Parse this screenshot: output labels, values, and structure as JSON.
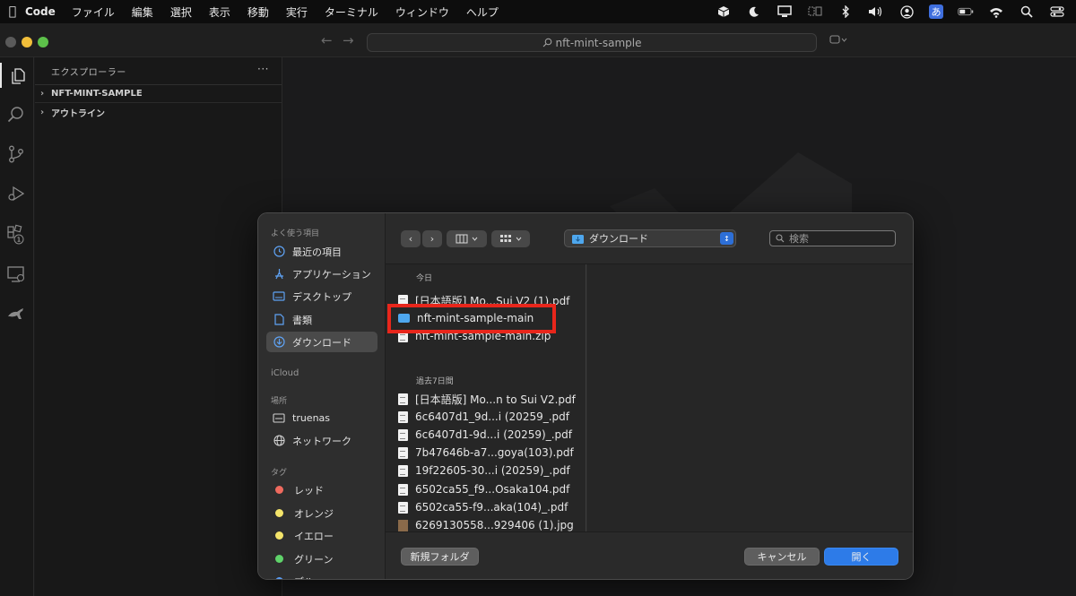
{
  "menubar": {
    "app_name": "Code",
    "menus": [
      "ファイル",
      "編集",
      "選択",
      "表示",
      "移動",
      "実行",
      "ターミナル",
      "ウィンドウ",
      "ヘルプ"
    ],
    "ime_label": "あ"
  },
  "window": {
    "command_center": "nft-mint-sample"
  },
  "explorer": {
    "title": "エクスプローラー",
    "more": "···",
    "folder": "NFT-MINT-SAMPLE",
    "outline": "アウトライン"
  },
  "activity": {
    "run_badge": "1"
  },
  "dialog": {
    "sidebar": {
      "favorites_label": "よく使う項目",
      "favorites": [
        {
          "label": "最近の項目",
          "icon": "clock-icon"
        },
        {
          "label": "アプリケーション",
          "icon": "apps-icon"
        },
        {
          "label": "デスクトップ",
          "icon": "desktop-icon"
        },
        {
          "label": "書類",
          "icon": "document-icon"
        },
        {
          "label": "ダウンロード",
          "icon": "download-icon",
          "selected": true
        }
      ],
      "icloud_label": "iCloud",
      "locations_label": "場所",
      "locations": [
        {
          "label": "truenas",
          "icon": "server-icon"
        },
        {
          "label": "ネットワーク",
          "icon": "globe-icon"
        }
      ],
      "tags_label": "タグ",
      "tags": [
        {
          "label": "レッド",
          "color": "#ef6a5e"
        },
        {
          "label": "オレンジ",
          "color": "#f4e46a"
        },
        {
          "label": "イエロー",
          "color": "#f4e46a"
        },
        {
          "label": "グリーン",
          "color": "#5fd36a"
        },
        {
          "label": "ブル",
          "color": "#5a9df5"
        }
      ]
    },
    "location_value": "ダウンロード",
    "search_placeholder": "検索",
    "today_label": "今日",
    "today_files": [
      {
        "name": "[日本語版] Mo...Sui V2 (1).pdf",
        "type": "pdf"
      },
      {
        "name": "nft-mint-sample-main",
        "type": "folder"
      },
      {
        "name": "nft-mint-sample-main.zip",
        "type": "zip"
      }
    ],
    "week_label": "過去7日間",
    "week_files": [
      {
        "name": "[日本語版] Mo...n to Sui V2.pdf",
        "type": "pdf"
      },
      {
        "name": "6c6407d1_9d...i (20259_.pdf",
        "type": "pdf"
      },
      {
        "name": "6c6407d1-9d...i (20259)_.pdf",
        "type": "pdf"
      },
      {
        "name": "7b47646b-a7...goya(103).pdf",
        "type": "pdf"
      },
      {
        "name": "19f22605-30...i (20259)_.pdf",
        "type": "pdf"
      },
      {
        "name": "6502ca55_f9...Osaka104.pdf",
        "type": "pdf"
      },
      {
        "name": "6502ca55-f9...aka(104)_.pdf",
        "type": "pdf"
      },
      {
        "name": "6269130558...929406 (1).jpg",
        "type": "jpg"
      }
    ],
    "new_folder": "新規フォルダ",
    "cancel": "キャンセル",
    "open": "開く"
  }
}
